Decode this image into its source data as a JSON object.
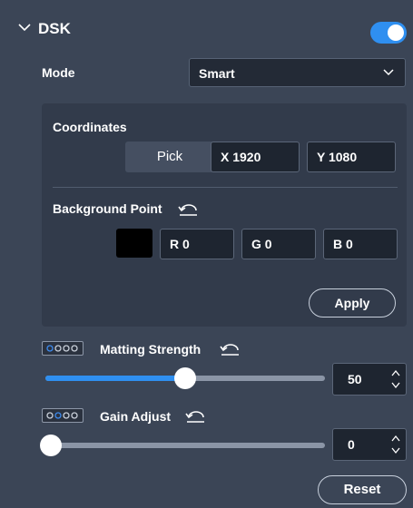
{
  "dsk": {
    "title": "DSK",
    "enabled": true,
    "accent": "#2f8ff0",
    "icons": {
      "collapse": "chevron-down-icon",
      "toggle": "toggle-switch"
    },
    "mode": {
      "label": "Mode",
      "value": "Smart",
      "icon": "chevron-down-icon"
    },
    "coordinates": {
      "label": "Coordinates",
      "pick_label": "Pick",
      "x": "X 1920",
      "y": "Y 1080"
    },
    "background_point": {
      "label": "Background Point",
      "reset_icon": "undo-icon",
      "swatch_color": "#000000",
      "r": "R 0",
      "g": "G 0",
      "b": "B 0",
      "apply_label": "Apply"
    },
    "matting_strength": {
      "label": "Matting Strength",
      "icon": "matting-strength-icon",
      "reset_icon": "undo-icon",
      "value": "50",
      "level": 0.5
    },
    "gain_adjust": {
      "label": "Gain Adjust",
      "icon": "gain-adjust-icon",
      "reset_icon": "undo-icon",
      "value": "0",
      "level": 0
    },
    "reset_label": "Reset"
  }
}
